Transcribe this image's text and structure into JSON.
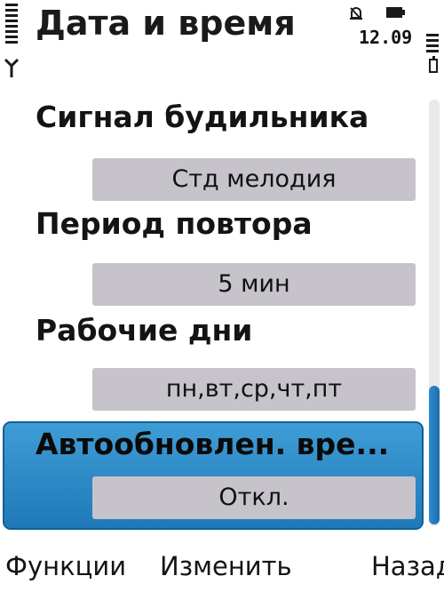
{
  "header": {
    "title": "Дата и время",
    "time": "12.09",
    "icons": [
      "signal-strength-icon",
      "antenna-icon",
      "alarm-icon",
      "battery-icon",
      "battery-level-icon"
    ]
  },
  "settings": [
    {
      "label": "Сигнал будильника",
      "value": "Стд мелодия"
    },
    {
      "label": "Период повтора",
      "value": "5 мин"
    },
    {
      "label": "Рабочие дни",
      "value": "пн,вт,ср,чт,пт"
    },
    {
      "label": "Автообновлен. вре...",
      "value": "Откл.",
      "selected": true
    }
  ],
  "softkeys": {
    "left": "Функции",
    "middle": "Изменить",
    "right": "Назад"
  },
  "colors": {
    "highlight": "#2f8ccc",
    "value_box": "#c6c3cb",
    "scroll_thumb": "#2e8ccd"
  }
}
